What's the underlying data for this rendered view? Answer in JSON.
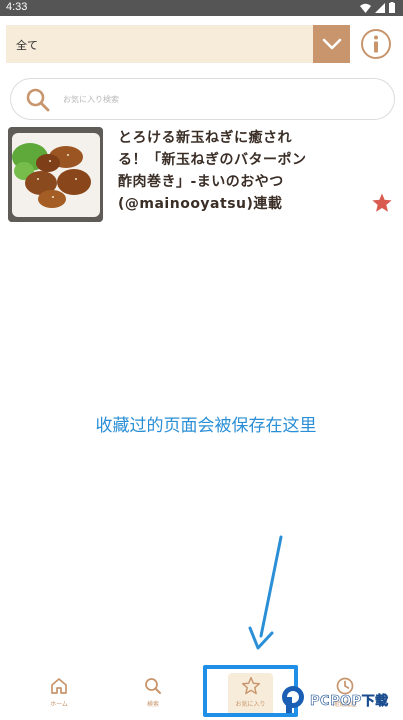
{
  "status_bar": {
    "time": "4:33"
  },
  "category": {
    "selected": "全て"
  },
  "search": {
    "placeholder": "お気に入り検索"
  },
  "favorites": [
    {
      "title": "とろける新玉ねぎに癒される！「新玉ねぎのバターポン酢肉巻き」-まいのおやつ(@mainooyatsu)連載",
      "starred": true
    }
  ],
  "annotation": {
    "text": "收藏过的页面会被保存在这里"
  },
  "bottom_nav": {
    "items": [
      {
        "label": "ホーム",
        "icon": "home-icon"
      },
      {
        "label": "検索",
        "icon": "search-icon"
      },
      {
        "label": "お気に入り",
        "icon": "star-icon",
        "active": true
      },
      {
        "label": "閲覧履歴",
        "icon": "clock-icon"
      }
    ]
  },
  "watermark": {
    "text": "PCPOP下载"
  },
  "colors": {
    "accent": "#c8956c",
    "header_bg": "#f7ecd9",
    "star": "#d95a4f",
    "annotation": "#2a8fd6"
  }
}
